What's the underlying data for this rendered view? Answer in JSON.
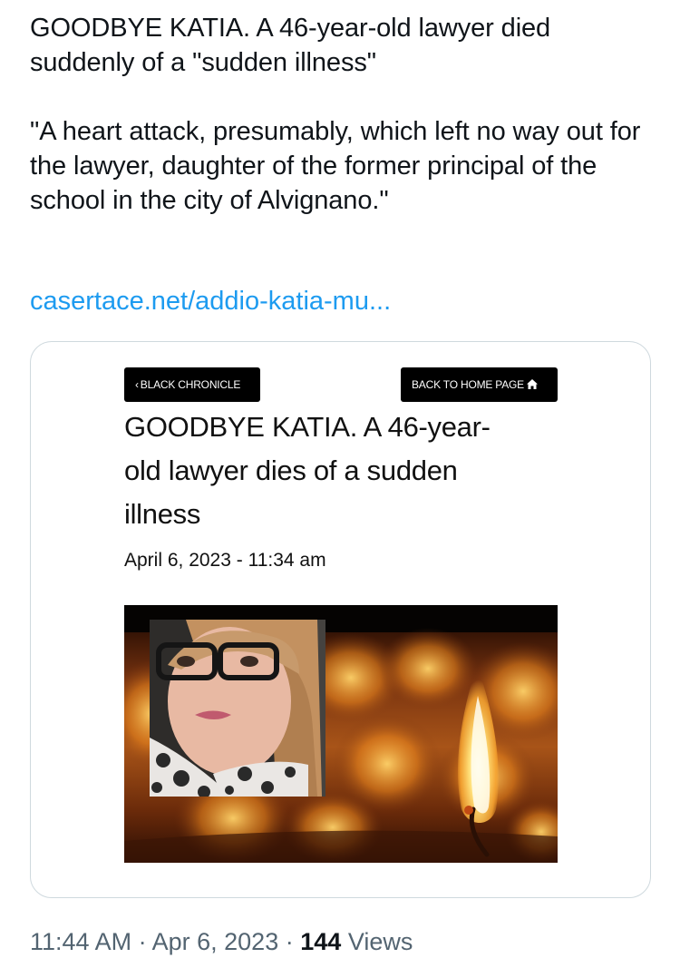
{
  "tweet": {
    "text_line1": "GOODBYE KATIA. A 46-year-old lawyer died suddenly of a \"sudden illness\"",
    "text_line2": "\"A heart attack, presumably, which left no way out for the lawyer, daughter of the former principal of the school in the city of Alvignano.\"",
    "link": "casertace.net/addio-katia-mu..."
  },
  "card": {
    "back_label": "BLACK CHRONICLE",
    "home_label": "BACK TO HOME PAGE",
    "title": "GOODBYE KATIA. A 46-year-old lawyer dies of a sudden illness",
    "date": "April 6, 2023 - 11:34 am",
    "icons": [
      "chevron-left-icon",
      "home-icon"
    ]
  },
  "meta": {
    "time": "11:44 AM",
    "separator": "·",
    "date": "Apr 6, 2023",
    "views_count": "144",
    "views_label": "Views"
  },
  "colors": {
    "link": "#1d9bf0",
    "meta": "#536471",
    "card_border": "#cfd9de"
  }
}
